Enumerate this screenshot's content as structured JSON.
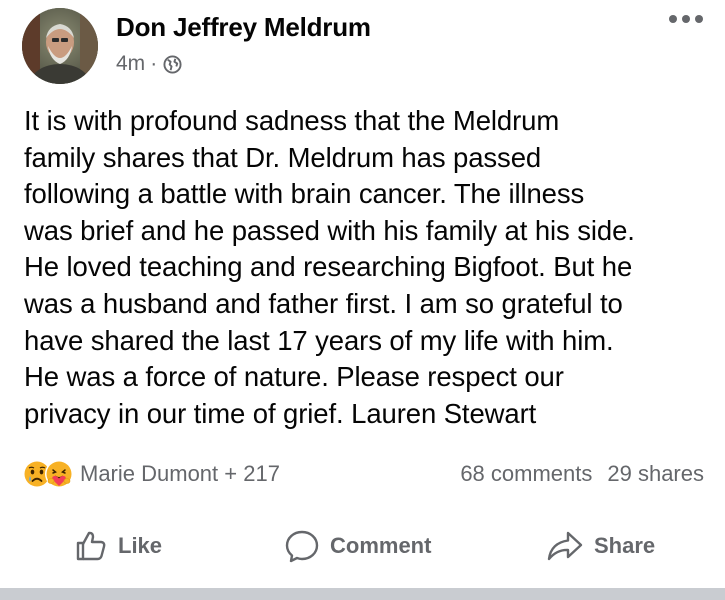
{
  "post": {
    "author": "Don Jeffrey Meldrum",
    "timestamp": "4m",
    "separator": "·",
    "audience_icon": "globe-icon",
    "menu_icon": "more-horizontal-icon",
    "body": "It is with profound sadness that the Meldrum\nfamily shares that Dr. Meldrum has passed\nfollowing a battle with brain cancer. The illness\nwas brief and he passed with his family at his side.\nHe loved teaching and researching Bigfoot. But he\nwas a husband and father first. I am so grateful to\nhave shared the last 17 years of my life with him.\nHe was a force of nature. Please respect our\nprivacy in our time of grief. Lauren Stewart"
  },
  "stats": {
    "reaction_icons": [
      "sad-reaction-icon",
      "care-reaction-icon"
    ],
    "reaction_names": "Marie Dumont + 217",
    "comments": "68 comments",
    "shares": "29 shares"
  },
  "actions": {
    "like": "Like",
    "comment": "Comment",
    "share": "Share"
  },
  "colors": {
    "text": "#050505",
    "secondary_text": "#65676b",
    "divider": "#c9ccd1",
    "reaction_yellow": "#f7b125",
    "reaction_red": "#f33e58"
  }
}
